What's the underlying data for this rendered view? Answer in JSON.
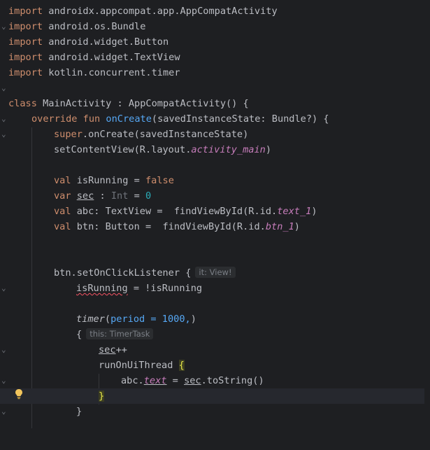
{
  "editor": {
    "lines": {
      "l1": {
        "kw": "import",
        "rest": " androidx.appcompat.app.AppCompatActivity"
      },
      "l2": {
        "kw": "import",
        "rest": " android.os.Bundle"
      },
      "l3": {
        "kw": "import",
        "rest": " android.widget.Button"
      },
      "l4": {
        "kw": "import",
        "rest": " android.widget.TextView"
      },
      "l5": {
        "kw": "import",
        "rest": " kotlin.concurrent.timer"
      },
      "l7": {
        "kw": "class",
        "name": " MainActivity : AppCompatActivity() {"
      },
      "l8": {
        "kw": "override fun",
        "fn": "onCreate",
        "rest": "(savedInstanceState: Bundle?) {"
      },
      "l9": {
        "kw": "super",
        "rest": ".onCreate(savedInstanceState)"
      },
      "l10": {
        "a": "setContentView(R.layout.",
        "prop": "activity_main",
        "b": ")"
      },
      "l12": {
        "kw": "val",
        "a": " isRunning = ",
        "kw2": "false"
      },
      "l13": {
        "kw": "var",
        "a": " ",
        "u": "sec",
        "b": " : ",
        "type": "Int",
        "c": " = ",
        "num": "0"
      },
      "l14": {
        "kw": "val",
        "a": " abc: TextView =  findViewById(R.id.",
        "prop": "text_1",
        "b": ")"
      },
      "l15": {
        "kw": "val",
        "a": " btn: Button =  findViewById(R.id.",
        "prop": "btn_1",
        "b": ")"
      },
      "l18": {
        "a": "btn.setOnClickListener {",
        "hint": "it: View!"
      },
      "l19": {
        "err": "isRunning",
        "a": " = !isRunning"
      },
      "l21": {
        "fn": "timer",
        "a": "(",
        "param": "period = 1000,",
        "b": ")"
      },
      "l22": {
        "a": "{",
        "hint": "this: TimerTask"
      },
      "l23": {
        "u": "sec",
        "a": "++"
      },
      "l24": {
        "a": "runOnUiThread ",
        "brace": "{"
      },
      "l25": {
        "a": "abc.",
        "prop": "text",
        "b": " = ",
        "u": "sec",
        "c": ".toString()"
      },
      "l26": {
        "brace": "}"
      },
      "l27": {
        "a": "}"
      }
    },
    "gutter": {
      "fold_glyph": "⌄",
      "bulb_icon": "lightbulb-icon"
    },
    "colors": {
      "background": "#1e1f22",
      "keyword": "#cf8e6d",
      "function": "#56a8f5",
      "property": "#c77dbb",
      "number": "#2aacb8",
      "text": "#bcbec4"
    }
  }
}
